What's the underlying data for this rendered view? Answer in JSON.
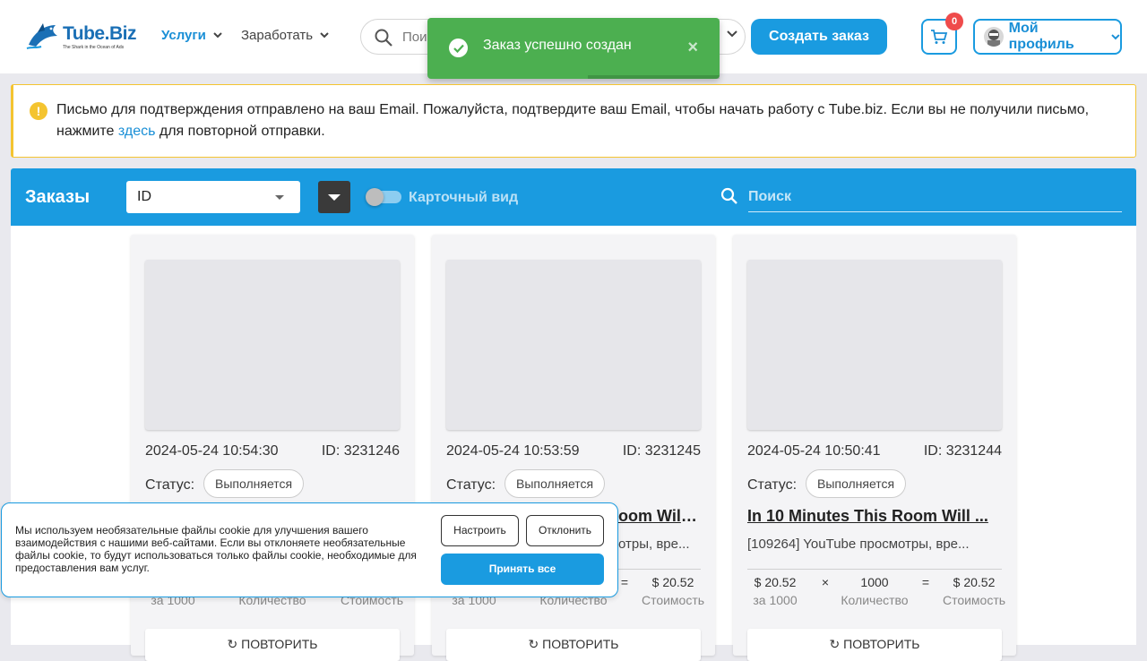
{
  "header": {
    "logo_text": "Tube.Biz",
    "logo_sub": "The Shark in the Ocean of Ads",
    "nav": [
      {
        "label": "Услуги"
      },
      {
        "label": "Заработать"
      }
    ],
    "search_placeholder": "Пои",
    "create_label": "Создать заказ",
    "cart_count": "0",
    "profile_label": "Мой профиль"
  },
  "toast": {
    "message": "Заказ успешно создан",
    "close_glyph": "×",
    "progress_fraction": 0.55
  },
  "warning": {
    "text_before": "Письмо для подтверждения отправлено на ваш Email. Пожалуйста, подтвердите ваш Email, чтобы начать работу с Tube.biz. Если вы не получили письмо, нажмите ",
    "link": "здесь",
    "text_after": " для повторной отправки."
  },
  "orders": {
    "title": "Заказы",
    "sort_value": "ID",
    "card_view_label": "Карточный вид",
    "search_placeholder": "Поиск"
  },
  "cards": [
    {
      "date": "2024-05-24 10:54:30",
      "id": "ID: 3231246",
      "status_label": "Статус:",
      "status": "Выполняется",
      "title": "",
      "service": "",
      "price": "",
      "qty": "",
      "cost": "",
      "price_label": "за 1000",
      "qty_label": "Количество",
      "cost_label": "Стоимость",
      "repeat": "ПОВТОРИТЬ"
    },
    {
      "date": "2024-05-24 10:53:59",
      "id": "ID: 3231245",
      "status_label": "Статус:",
      "status": "Выполняется",
      "title": "oom Will ...",
      "service": "отры, вре...",
      "price": "",
      "qty": "",
      "cost": "$ 20.52",
      "price_label": "за 1000",
      "qty_label": "Количество",
      "cost_label": "Стоимость",
      "repeat": "ПОВТОРИТЬ"
    },
    {
      "date": "2024-05-24 10:50:41",
      "id": "ID: 3231244",
      "status_label": "Статус:",
      "status": "Выполняется",
      "title": "In 10 Minutes This Room Will ...",
      "service": "[109264] YouTube просмотры, вре...",
      "price": "$ 20.52",
      "qty": "1000",
      "cost": "$ 20.52",
      "price_label": "за 1000",
      "qty_label": "Количество",
      "cost_label": "Стоимость",
      "repeat": "ПОВТОРИТЬ"
    }
  ],
  "calc_symbols": {
    "times": "×",
    "equals": "="
  },
  "cookie": {
    "text": "Мы используем необязательные файлы cookie для улучшения вашего взаимодействия с нашими веб-сайтами. Если вы отклоняете необязательные файлы cookie, то будут использоваться только файлы cookie, необходимые для предоставления вам услуг.",
    "configure": "Настроить",
    "decline": "Отклонить",
    "accept": "Принять все"
  },
  "colors": {
    "brand": "#1a9be0",
    "success": "#4caf50",
    "warning": "#f4c430",
    "badge": "#ef4b4b"
  }
}
